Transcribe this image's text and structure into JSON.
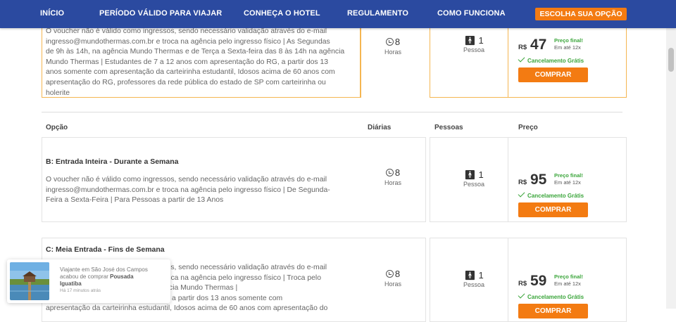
{
  "nav": {
    "items": [
      "INÍCIO",
      "PERÍODO VÁLIDO PARA VIAJAR",
      "CONHEÇA O HOTEL",
      "REGULAMENTO",
      "COMO FUNCIONA"
    ],
    "cta": "ESCOLHA SUA OPÇÃO"
  },
  "table_header": {
    "option": "Opção",
    "nights": "Diárias",
    "people": "Pessoas",
    "price": "Preço"
  },
  "options": [
    {
      "title": "",
      "lines": [
        "O voucher não é válido como ingressos, sendo necessário validação através do e-mail",
        "ingresso@mundothermas.com.br e troca na agência pelo ingresso físico | As Segundas",
        "de 9h às 14h, na agência Mundo Thermas e de Terça a Sexta-feira das 8 às 14h na agência",
        "Mundo Thermas | Estudantes de 7 a 12 anos com apresentação do RG, a partir dos 13",
        "anos somente com apresentação da carteirinha estudantil, Idosos acima de 60 anos com",
        "apresentação do RG, professores da rede pública do estado de SP com carteirinha ou",
        "holerite"
      ],
      "nights": "8",
      "nights_label": "Horas",
      "people": "1",
      "people_label": "Pessoa",
      "currency": "R$",
      "price": "47",
      "final_label": "Preço final!",
      "installments": "Em até 12x",
      "cancellation": "Cancelamento Grátis",
      "button": "COMPRAR"
    },
    {
      "title": "B: Entrada Inteira - Durante a Semana",
      "lines": [
        "O voucher não é válido como ingressos, sendo necessário validação através do e-mail",
        "ingresso@mundothermas.com.br e troca na agência pelo ingresso físico | De Segunda-",
        "Feira a Sexta-Feira | Para Pessoas a partir de 13 Anos"
      ],
      "nights": "8",
      "nights_label": "Horas",
      "people": "1",
      "people_label": "Pessoa",
      "currency": "R$",
      "price": "95",
      "final_label": "Preço final!",
      "installments": "Em até 12x",
      "cancellation": "Cancelamento Grátis",
      "button": "COMPRAR"
    },
    {
      "title": "C: Meia Entrada - Fins de Semana",
      "lines": [
        "O voucher não é válido como ingressos, sendo necessário validação através do e-mail",
        "ingresso@mundothermas.com.br e troca na agência pelo ingresso físico | Troca pelo",
        "ingresso físico das 8h às 10h na agência Mundo Thermas |",
        "Estudantes com apresentação do RG, a partir dos 13 anos somente com",
        "apresentação da carteirinha estudantil, Idosos acima de 60 anos com apresentação do"
      ],
      "nights": "8",
      "nights_label": "Horas",
      "people": "1",
      "people_label": "Pessoa",
      "currency": "R$",
      "price": "59",
      "final_label": "Preço final!",
      "installments": "Em até 12x",
      "cancellation": "Cancelamento Grátis",
      "button": "COMPRAR"
    }
  ],
  "toast": {
    "line1": "Viajante em São José dos Campos",
    "line2_prefix": "acabou de comprar",
    "line2_bold": "Pousada",
    "line3": "Iguatiba",
    "time": "Há 17 minutos atrás"
  },
  "colors": {
    "nav": "#2b4aa0",
    "accent": "#f37b12",
    "success": "#3aa53a",
    "highlight_border": "#f5b651"
  }
}
